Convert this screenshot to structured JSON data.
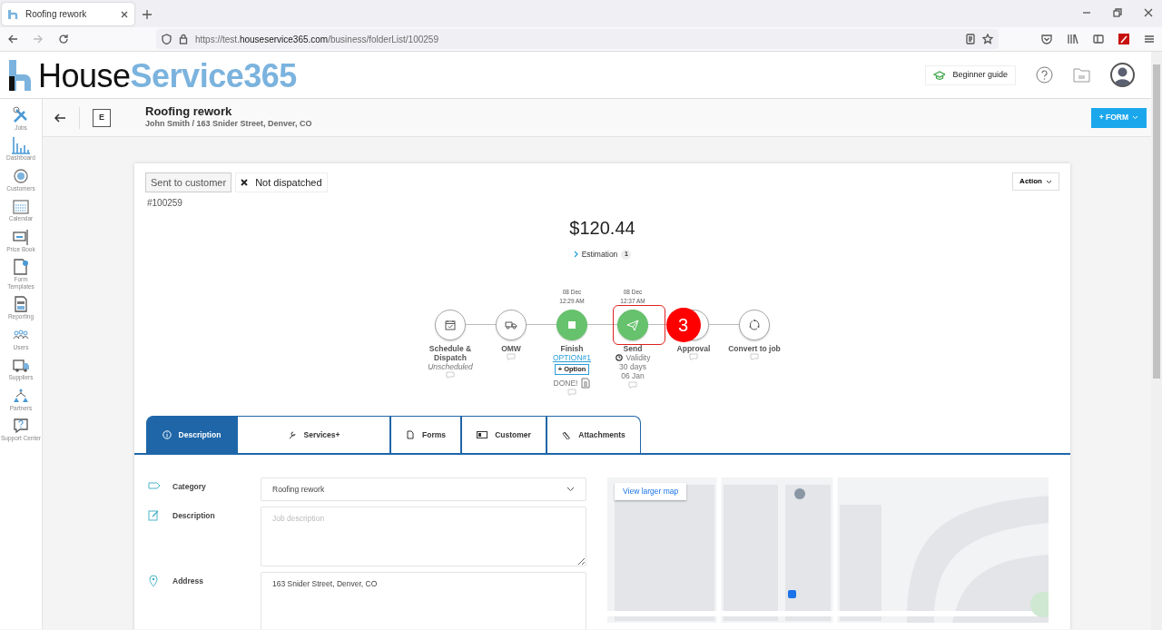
{
  "browser": {
    "tab_title": "Roofing rework",
    "url": "https://test.**houseservice365.com**/business/folderList/100259"
  },
  "header": {
    "logo": "House**Service365**",
    "guide_button": "Beginner guide"
  },
  "sidebar": {
    "items": [
      {
        "label": "Jobs"
      },
      {
        "label": "Dashboard"
      },
      {
        "label": "Customers"
      },
      {
        "label": "Calendar"
      },
      {
        "label": "Price Book"
      },
      {
        "label": "Form Templates"
      },
      {
        "label": "Reporting"
      },
      {
        "label": "Users"
      },
      {
        "label": "Suppliers"
      },
      {
        "label": "Partners"
      },
      {
        "label": "Support Center"
      }
    ]
  },
  "job": {
    "type_badge": "E",
    "title": "Roofing rework",
    "subtitle": "John Smith / 163 Snider Street, Denver, CO",
    "form_button": "+ FORM"
  },
  "card": {
    "tags": [
      {
        "label": "Sent to customer",
        "kind": "status"
      },
      {
        "label": "Not dispatched",
        "kind": "dispatch"
      }
    ],
    "action_button": "Action",
    "number": "#100259",
    "amount": "$120.44",
    "estimation": {
      "label": "Estimation",
      "count": "1"
    },
    "steps": [
      {
        "kind": "schedule",
        "label": "Schedule & Dispatch",
        "done": false,
        "note": "Unscheduled"
      },
      {
        "kind": "omw",
        "label": "OMW",
        "done": false
      },
      {
        "kind": "finish",
        "label": "Finish",
        "done": true,
        "date": "08 Dec",
        "time": "12:29 AM",
        "option_link": "OPTION#1",
        "option_button": "+ Option",
        "status": "DONE!"
      },
      {
        "kind": "send",
        "label": "Send",
        "done": true,
        "date": "08 Dec",
        "time": "12:37 AM",
        "highlighted": true,
        "validity": "Validity",
        "lines": [
          "30 days",
          "06 Jan"
        ]
      },
      {
        "kind": "approval",
        "label": "Approval",
        "done": false
      },
      {
        "kind": "convert",
        "label": "Convert to job",
        "done": false
      }
    ],
    "tabs": [
      {
        "label": "Description",
        "kind": "info",
        "selected": true
      },
      {
        "label": "Services+",
        "kind": "wrench",
        "selected": false
      },
      {
        "label": "Forms",
        "kind": "doc",
        "selected": false
      },
      {
        "label": "Customer",
        "kind": "card",
        "selected": false
      },
      {
        "label": "Attachments",
        "kind": "clip",
        "selected": false
      }
    ],
    "fields": [
      {
        "kind": "select",
        "label": "Category",
        "value": "Roofing rework"
      },
      {
        "kind": "textarea",
        "label": "Description",
        "placeholder": "Job description"
      },
      {
        "kind": "address",
        "label": "Address",
        "value": "163 Snider Street, Denver, CO"
      }
    ],
    "map": {
      "kind": "picture",
      "button": "View larger map"
    }
  },
  "annotation": {
    "label": "3"
  }
}
